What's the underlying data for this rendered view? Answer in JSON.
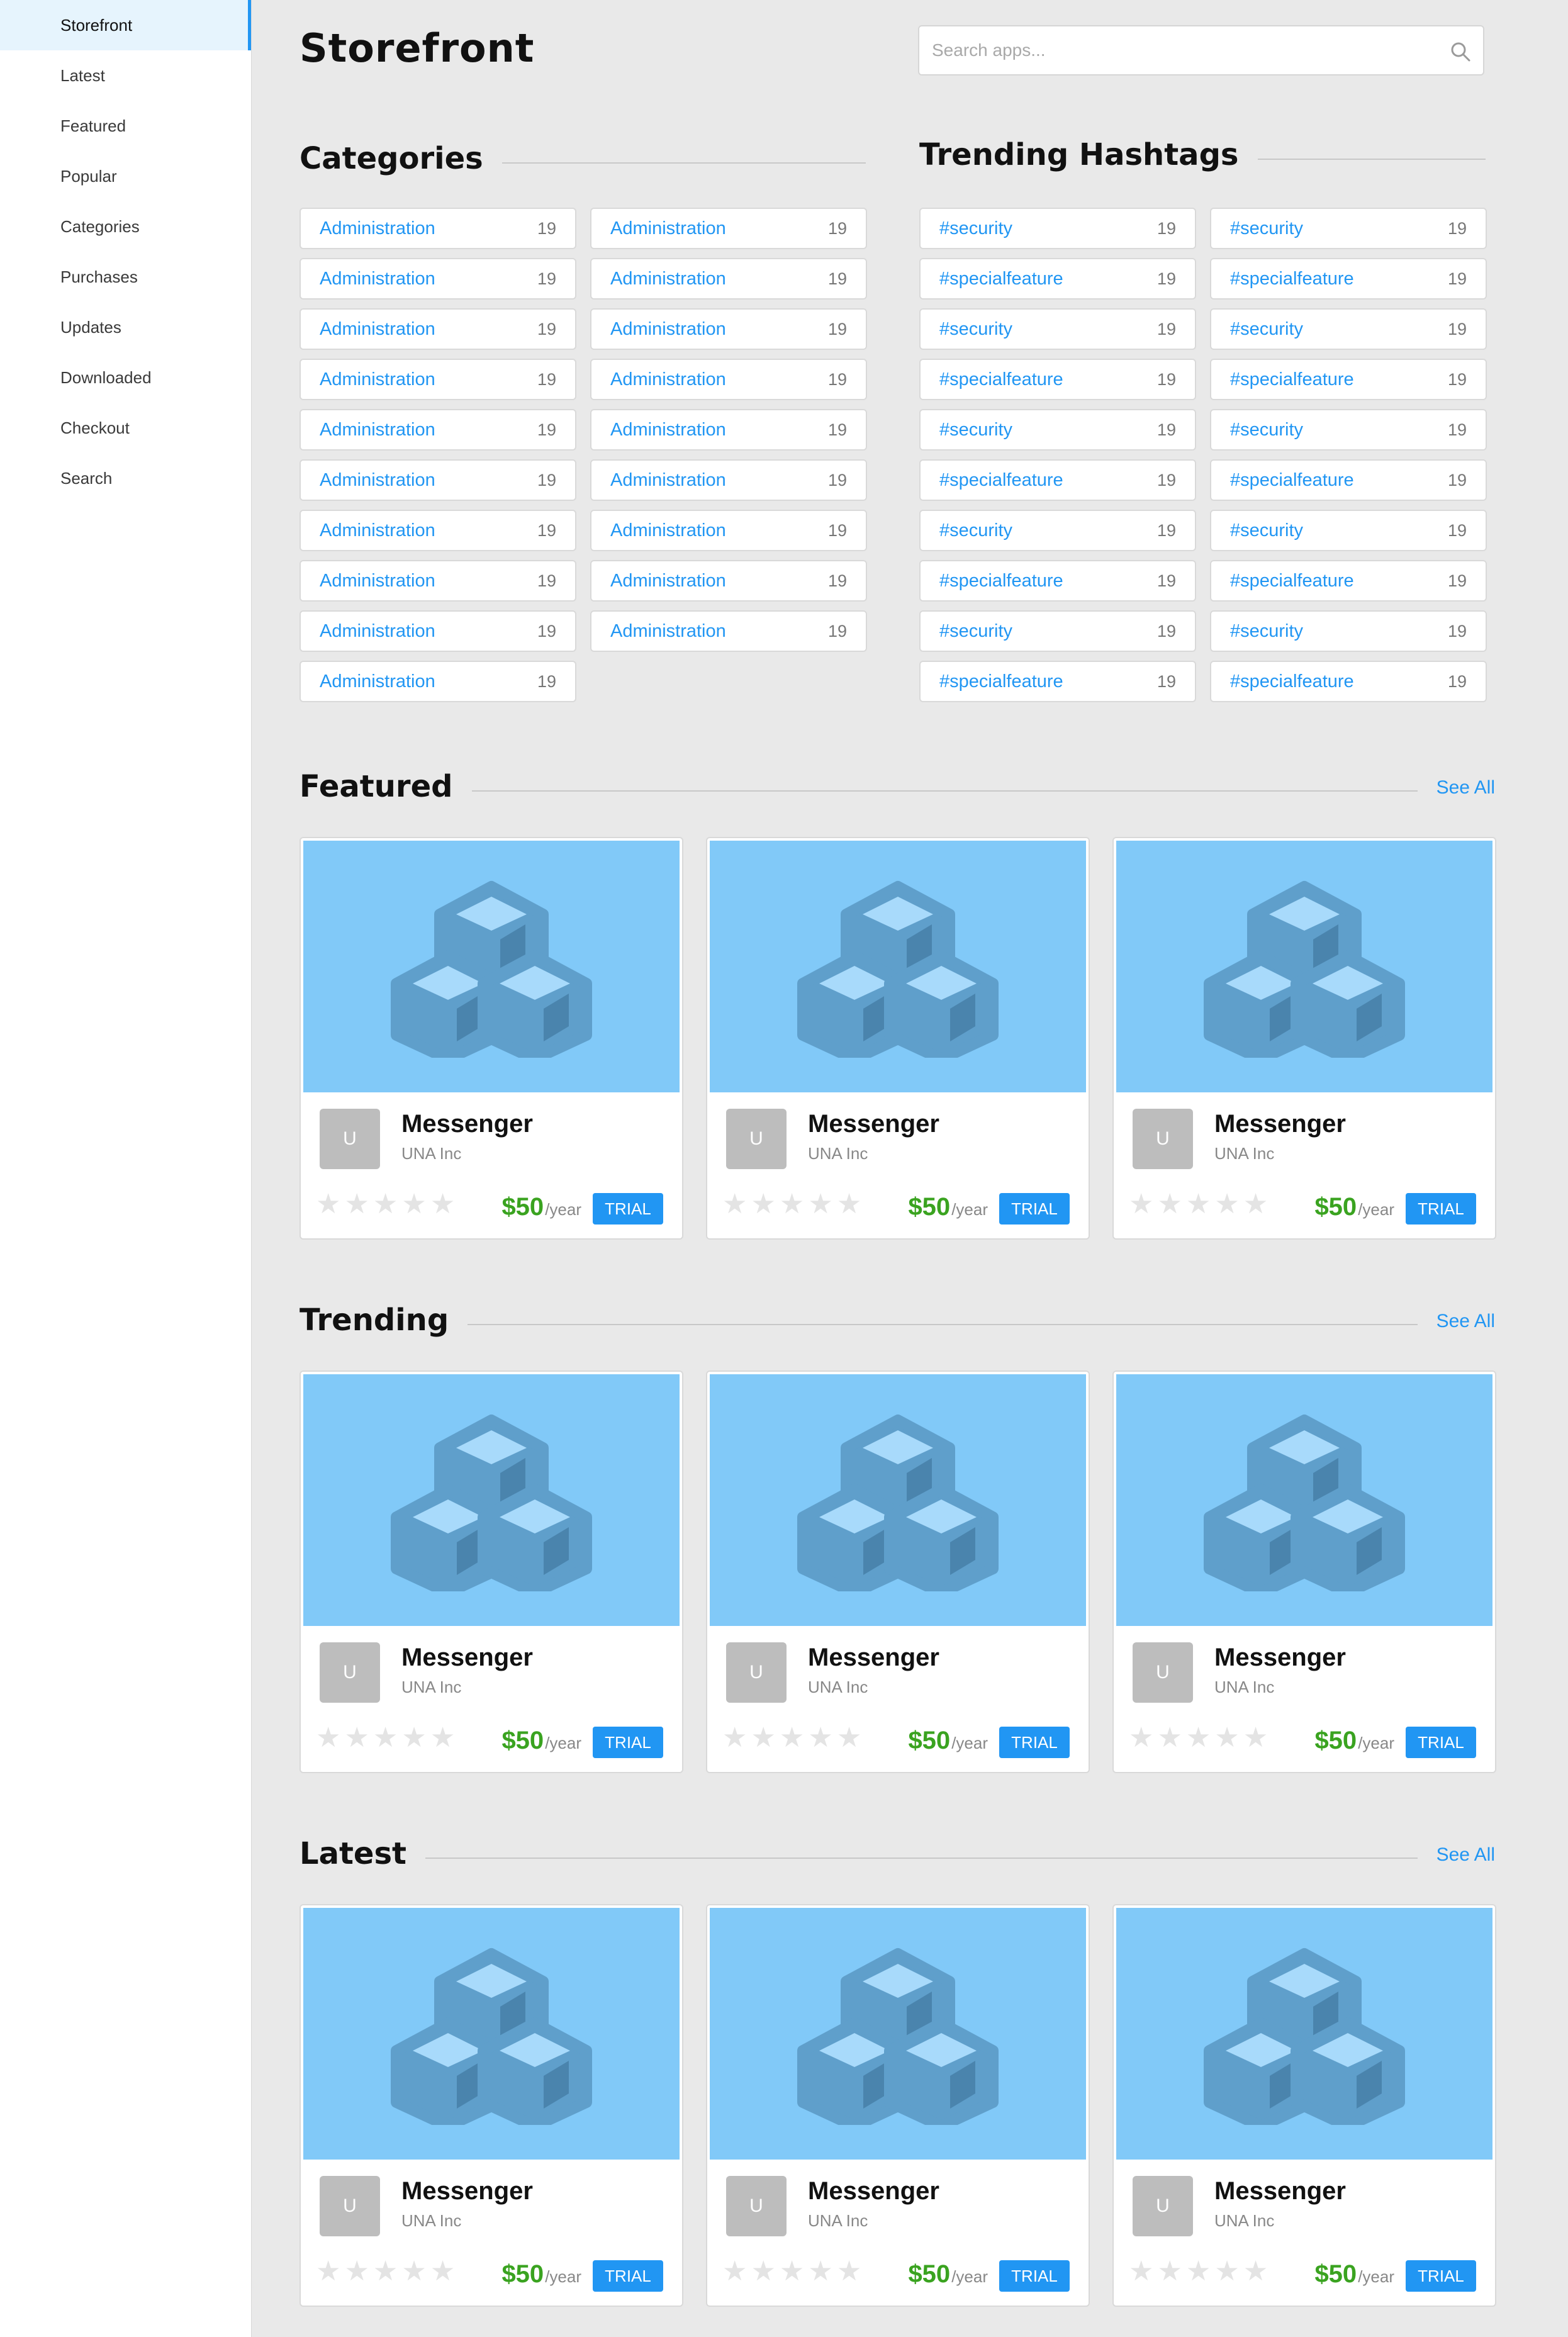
{
  "sidebar": {
    "items": [
      {
        "label": "Storefront",
        "active": true
      },
      {
        "label": "Latest"
      },
      {
        "label": "Featured"
      },
      {
        "label": "Popular"
      },
      {
        "label": "Categories"
      },
      {
        "label": "Purchases"
      },
      {
        "label": "Updates"
      },
      {
        "label": "Downloaded"
      },
      {
        "label": "Checkout"
      },
      {
        "label": "Search"
      }
    ]
  },
  "header": {
    "title": "Storefront",
    "search_placeholder": "Search apps..."
  },
  "categories": {
    "title": "Categories",
    "items": [
      {
        "label": "Administration",
        "count": "19"
      },
      {
        "label": "Administration",
        "count": "19"
      },
      {
        "label": "Administration",
        "count": "19"
      },
      {
        "label": "Administration",
        "count": "19"
      },
      {
        "label": "Administration",
        "count": "19"
      },
      {
        "label": "Administration",
        "count": "19"
      },
      {
        "label": "Administration",
        "count": "19"
      },
      {
        "label": "Administration",
        "count": "19"
      },
      {
        "label": "Administration",
        "count": "19"
      },
      {
        "label": "Administration",
        "count": "19"
      },
      {
        "label": "Administration",
        "count": "19"
      },
      {
        "label": "Administration",
        "count": "19"
      },
      {
        "label": "Administration",
        "count": "19"
      },
      {
        "label": "Administration",
        "count": "19"
      },
      {
        "label": "Administration",
        "count": "19"
      },
      {
        "label": "Administration",
        "count": "19"
      },
      {
        "label": "Administration",
        "count": "19"
      },
      {
        "label": "Administration",
        "count": "19"
      },
      {
        "label": "Administration",
        "count": "19"
      }
    ]
  },
  "hashtags": {
    "title": "Trending Hashtags",
    "items": [
      {
        "label": "#security",
        "count": "19"
      },
      {
        "label": "#security",
        "count": "19"
      },
      {
        "label": "#specialfeature",
        "count": "19"
      },
      {
        "label": "#specialfeature",
        "count": "19"
      },
      {
        "label": "#security",
        "count": "19"
      },
      {
        "label": "#security",
        "count": "19"
      },
      {
        "label": "#specialfeature",
        "count": "19"
      },
      {
        "label": "#specialfeature",
        "count": "19"
      },
      {
        "label": "#security",
        "count": "19"
      },
      {
        "label": "#security",
        "count": "19"
      },
      {
        "label": "#specialfeature",
        "count": "19"
      },
      {
        "label": "#specialfeature",
        "count": "19"
      },
      {
        "label": "#security",
        "count": "19"
      },
      {
        "label": "#security",
        "count": "19"
      },
      {
        "label": "#specialfeature",
        "count": "19"
      },
      {
        "label": "#specialfeature",
        "count": "19"
      },
      {
        "label": "#security",
        "count": "19"
      },
      {
        "label": "#security",
        "count": "19"
      },
      {
        "label": "#specialfeature",
        "count": "19"
      },
      {
        "label": "#specialfeature",
        "count": "19"
      }
    ]
  },
  "sections": [
    {
      "id": "featured",
      "title": "Featured",
      "see_all": "See All",
      "apps": [
        {
          "avatar": "U",
          "name": "Messenger",
          "vendor": "UNA Inc",
          "price": "$50",
          "period": "/year",
          "badge": "TRIAL",
          "rating": 0
        },
        {
          "avatar": "U",
          "name": "Messenger",
          "vendor": "UNA Inc",
          "price": "$50",
          "period": "/year",
          "badge": "TRIAL",
          "rating": 0
        },
        {
          "avatar": "U",
          "name": "Messenger",
          "vendor": "UNA Inc",
          "price": "$50",
          "period": "/year",
          "badge": "TRIAL",
          "rating": 0
        }
      ]
    },
    {
      "id": "trending",
      "title": "Trending",
      "see_all": "See All",
      "apps": [
        {
          "avatar": "U",
          "name": "Messenger",
          "vendor": "UNA Inc",
          "price": "$50",
          "period": "/year",
          "badge": "TRIAL",
          "rating": 0
        },
        {
          "avatar": "U",
          "name": "Messenger",
          "vendor": "UNA Inc",
          "price": "$50",
          "period": "/year",
          "badge": "TRIAL",
          "rating": 0
        },
        {
          "avatar": "U",
          "name": "Messenger",
          "vendor": "UNA Inc",
          "price": "$50",
          "period": "/year",
          "badge": "TRIAL",
          "rating": 0
        }
      ]
    },
    {
      "id": "latest",
      "title": "Latest",
      "see_all": "See All",
      "apps": [
        {
          "avatar": "U",
          "name": "Messenger",
          "vendor": "UNA Inc",
          "price": "$50",
          "period": "/year",
          "badge": "TRIAL",
          "rating": 0
        },
        {
          "avatar": "U",
          "name": "Messenger",
          "vendor": "UNA Inc",
          "price": "$50",
          "period": "/year",
          "badge": "TRIAL",
          "rating": 0
        },
        {
          "avatar": "U",
          "name": "Messenger",
          "vendor": "UNA Inc",
          "price": "$50",
          "period": "/year",
          "badge": "TRIAL",
          "rating": 0
        }
      ]
    }
  ],
  "icons": {
    "search": "search-icon",
    "app_thumbnail": "cubes-icon",
    "rating": "star-icon"
  },
  "colors": {
    "accent": "#2196f3",
    "thumbnail_bg": "#81c9f8",
    "cubes": "#5f9fcb",
    "price": "#3aa320",
    "avatar_bg": "#bdbdbd",
    "star_empty": "#e4e4e4"
  }
}
